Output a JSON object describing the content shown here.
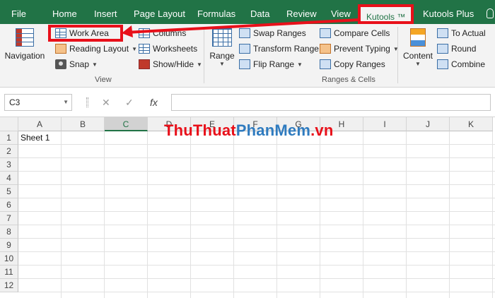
{
  "tabs": [
    {
      "label": "File"
    },
    {
      "label": "Home"
    },
    {
      "label": "Insert"
    },
    {
      "label": "Page Layout"
    },
    {
      "label": "Formulas"
    },
    {
      "label": "Data"
    },
    {
      "label": "Review"
    },
    {
      "label": "View"
    },
    {
      "label": "Kutools ™"
    },
    {
      "label": "Kutools Plus"
    }
  ],
  "active_tab": "Kutools ™",
  "view_group": {
    "label": "View",
    "navigation": "Navigation",
    "work_area": "Work Area",
    "reading_layout": "Reading Layout",
    "snap": "Snap",
    "columns": "Columns",
    "worksheets": "Worksheets",
    "show_hide": "Show/Hide"
  },
  "ranges_group": {
    "label": "Ranges & Cells",
    "range": "Range",
    "swap_ranges": "Swap Ranges",
    "transform_range": "Transform Range",
    "flip_range": "Flip Range",
    "compare_cells": "Compare Cells",
    "prevent_typing": "Prevent Typing",
    "copy_ranges": "Copy Ranges",
    "content": "Content",
    "to_actual": "To Actual",
    "round": "Round",
    "combine": "Combine"
  },
  "formula_bar": {
    "name_box": "C3",
    "fx": "fx",
    "cancel": "✕",
    "enter": "✓",
    "formula": ""
  },
  "columns": [
    "A",
    "B",
    "C",
    "D",
    "E",
    "F",
    "G",
    "H",
    "I",
    "J",
    "K"
  ],
  "selected_column": "C",
  "rows": [
    "1",
    "2",
    "3",
    "4",
    "5",
    "6",
    "7",
    "8",
    "9",
    "10",
    "11",
    "12"
  ],
  "cells": {
    "A1": "Sheet 1"
  },
  "watermark": {
    "part1": "ThuThuat",
    "part2": "PhanMem",
    "part3": ".vn"
  },
  "colors": {
    "ribbon_green": "#217346",
    "highlight_red": "#e8101a"
  }
}
